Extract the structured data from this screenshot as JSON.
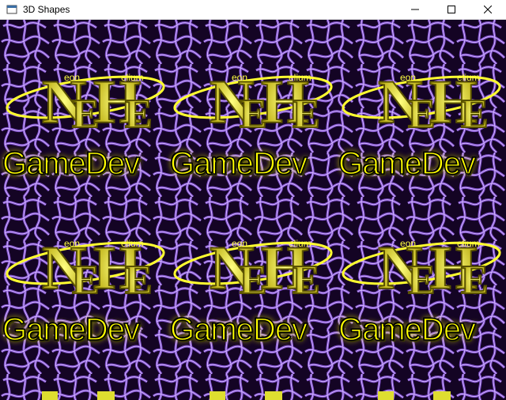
{
  "window": {
    "title": "3D Shapes",
    "icon": "app-window-icon",
    "controls": [
      "minimize-icon",
      "maximize-icon",
      "close-icon"
    ]
  },
  "scene": {
    "background_color": "#2a0a4a",
    "vein_color": "#8a5ad0",
    "accent_color": "#ffff00",
    "tiles": [
      {
        "brand_left": "eon",
        "brand_right": "elium",
        "caption": "GameDev"
      },
      {
        "brand_left": "eon",
        "brand_right": "elium",
        "caption": "GameDev"
      },
      {
        "brand_left": "eon",
        "brand_right": "elium",
        "caption": "GameDev"
      },
      {
        "brand_left": "eon",
        "brand_right": "elium",
        "caption": "GameDev"
      },
      {
        "brand_left": "eon",
        "brand_right": "elium",
        "caption": "GameDev"
      },
      {
        "brand_left": "eon",
        "brand_right": "elium",
        "caption": "GameDev"
      }
    ]
  }
}
